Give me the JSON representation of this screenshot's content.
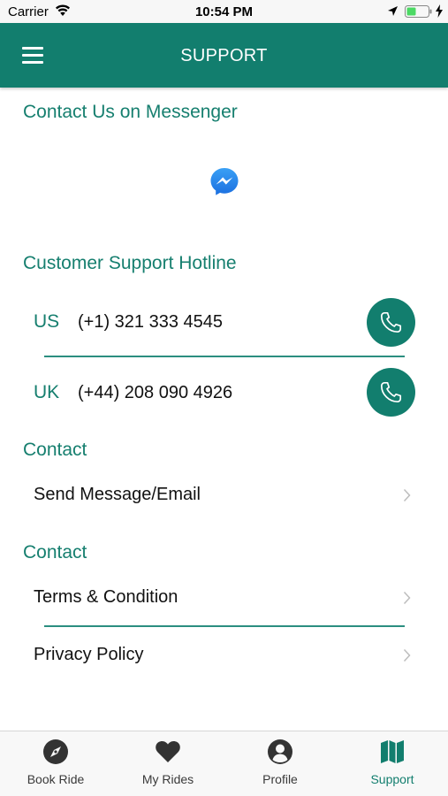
{
  "status_bar": {
    "carrier": "Carrier",
    "time": "10:54 PM"
  },
  "header": {
    "title": "SUPPORT",
    "color": "#127e6e"
  },
  "messenger_section": {
    "title": "Contact Us on Messenger",
    "icon": "messenger-icon"
  },
  "hotline_section": {
    "title": "Customer Support Hotline",
    "lines": [
      {
        "country": "US",
        "number": "(+1) 321 333 4545"
      },
      {
        "country": "UK",
        "number": "(+44) 208 090 4926"
      }
    ]
  },
  "contact_section": {
    "title": "Contact",
    "items": [
      {
        "label": "Send Message/Email"
      }
    ]
  },
  "legal_section": {
    "title": "Contact",
    "items": [
      {
        "label": "Terms & Condition"
      },
      {
        "label": "Privacy Policy"
      }
    ]
  },
  "tab_bar": {
    "tabs": [
      {
        "label": "Book Ride",
        "icon": "compass-icon"
      },
      {
        "label": "My Rides",
        "icon": "heart-icon"
      },
      {
        "label": "Profile",
        "icon": "user-icon"
      },
      {
        "label": "Support",
        "icon": "map-icon",
        "active": true
      }
    ],
    "active_color": "#127e6e"
  }
}
